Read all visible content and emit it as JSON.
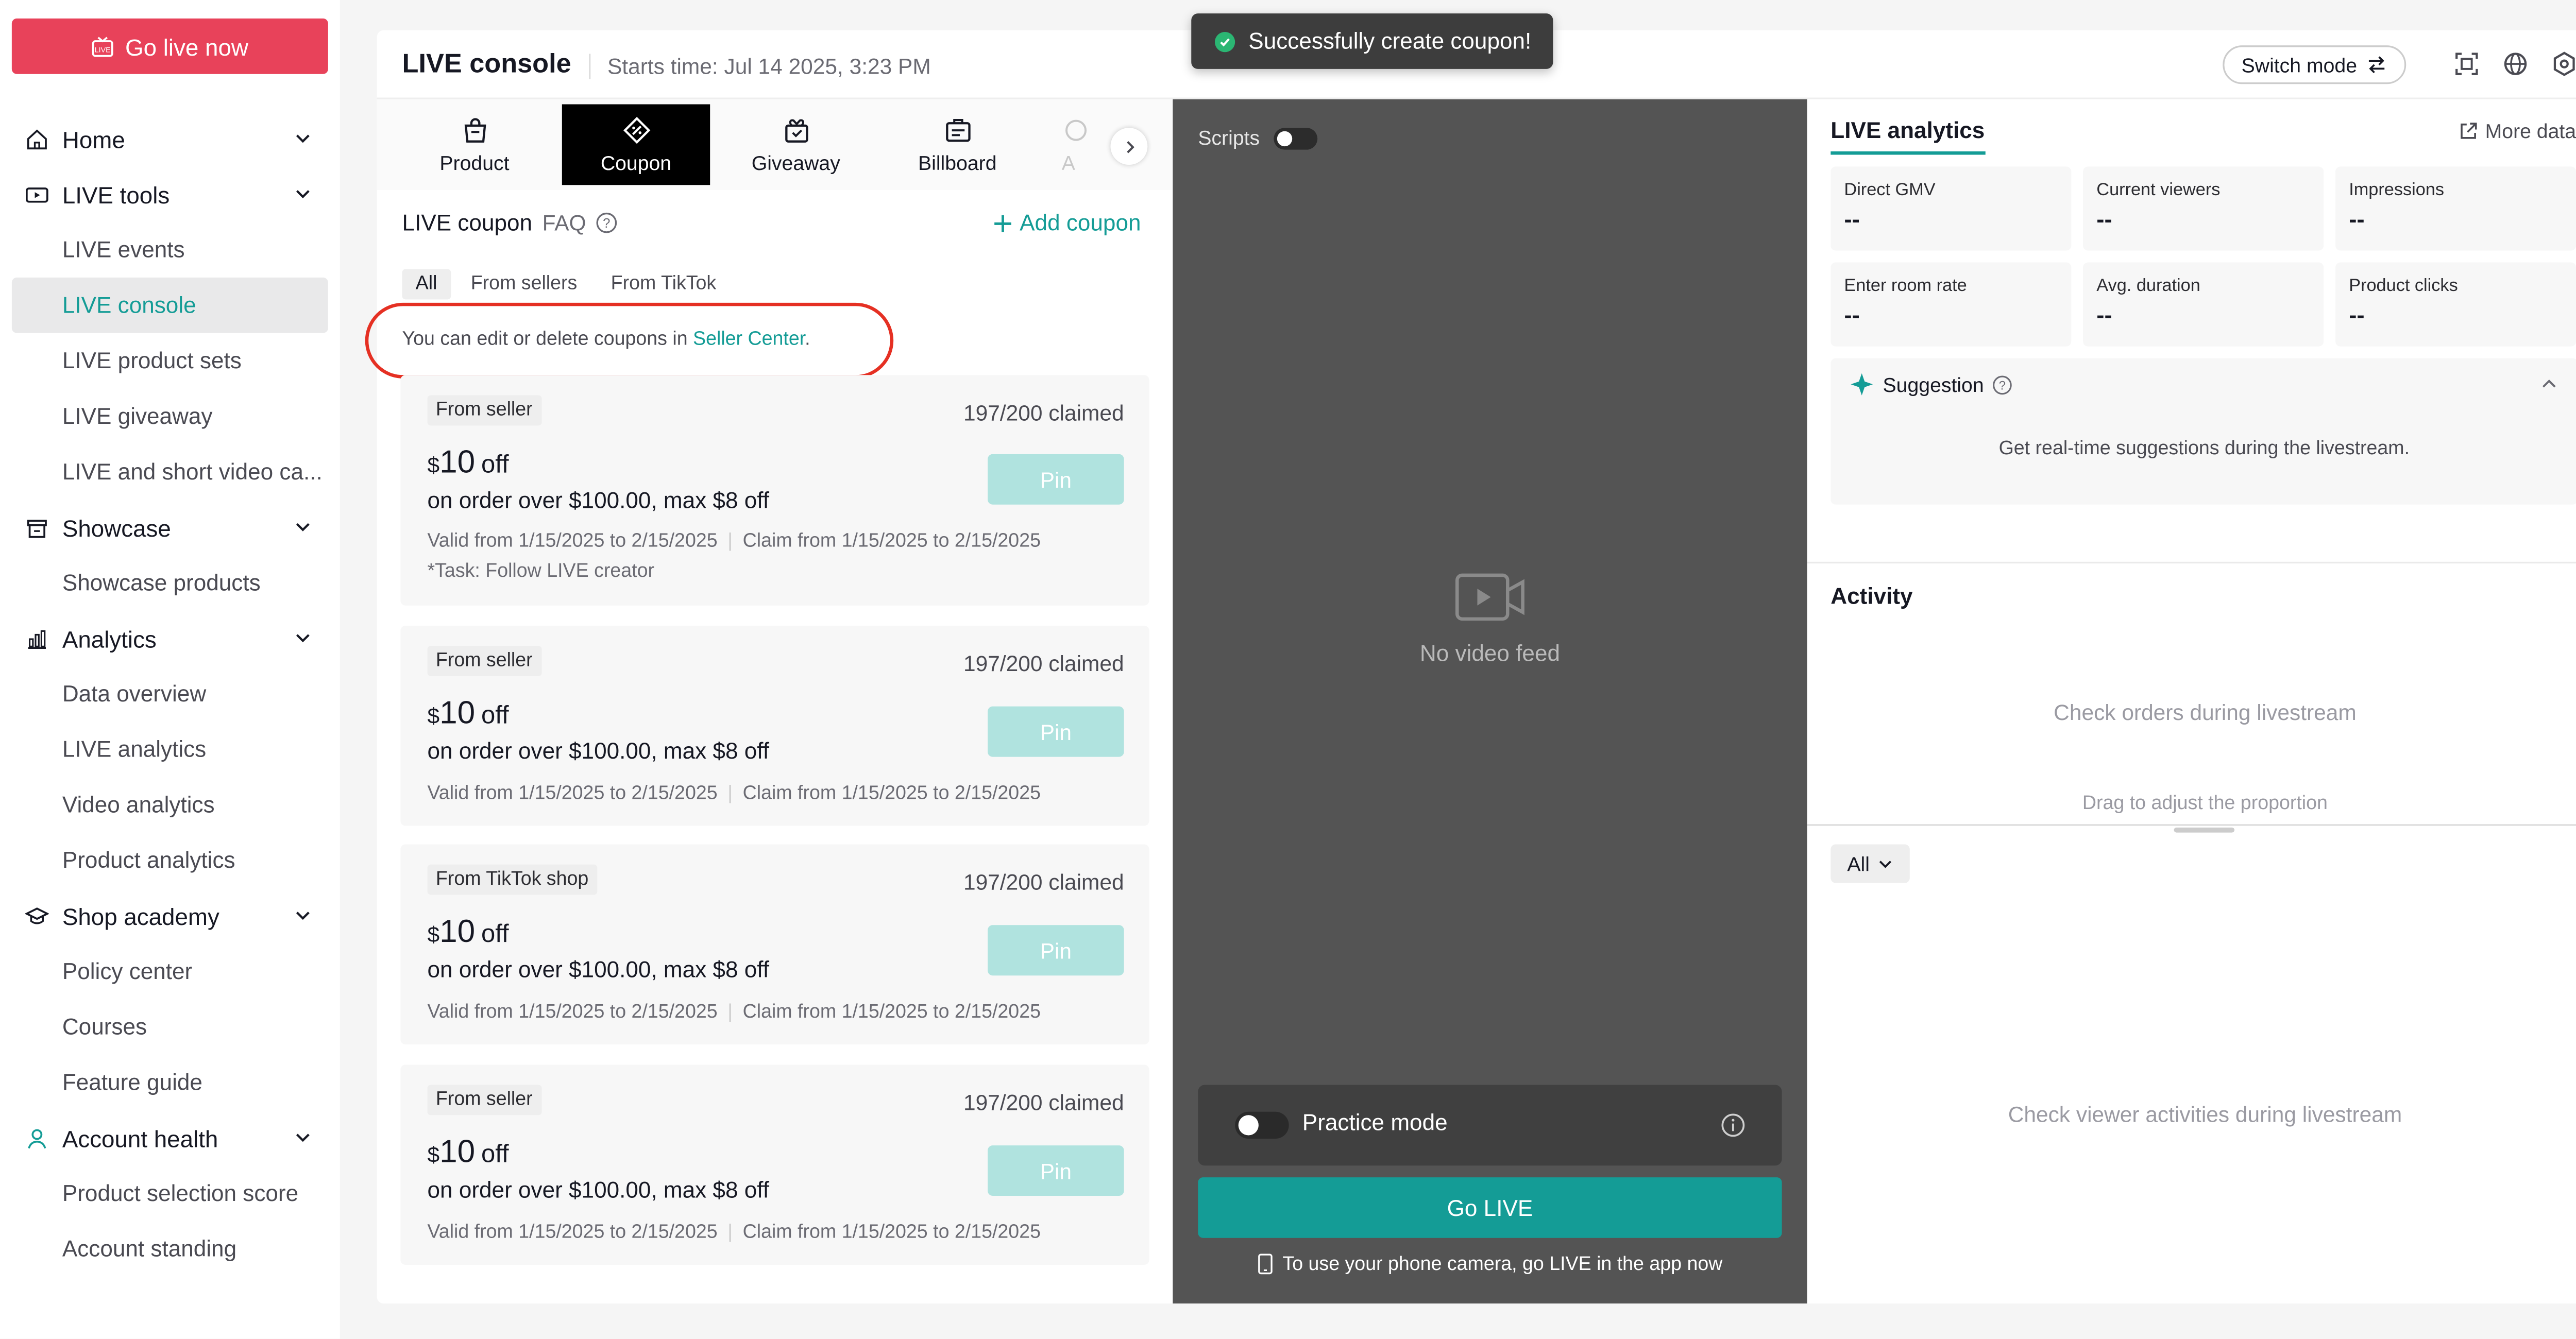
{
  "sidebar": {
    "go_live_label": "Go live now",
    "groups": [
      {
        "label": "Home",
        "icon": "home-icon",
        "subs": []
      },
      {
        "label": "LIVE tools",
        "icon": "live-tools-icon",
        "subs": [
          "LIVE events",
          "LIVE console",
          "LIVE product sets",
          "LIVE giveaway",
          "LIVE and short video ca..."
        ]
      },
      {
        "label": "Showcase",
        "icon": "showcase-icon",
        "subs": [
          "Showcase products"
        ]
      },
      {
        "label": "Analytics",
        "icon": "analytics-icon",
        "subs": [
          "Data overview",
          "LIVE analytics",
          "Video analytics",
          "Product analytics"
        ]
      },
      {
        "label": "Shop academy",
        "icon": "academy-icon",
        "subs": [
          "Policy center",
          "Courses",
          "Feature guide"
        ]
      },
      {
        "label": "Account health",
        "icon": "account-icon",
        "subs": [
          "Product selection score",
          "Account standing"
        ]
      }
    ],
    "active": "LIVE console"
  },
  "header": {
    "title": "LIVE console",
    "starts": "Starts time: Jul 14 2025, 3:23 PM",
    "switch_mode": "Switch mode"
  },
  "toast": {
    "text": "Successfully create coupon!"
  },
  "tabs": [
    {
      "label": "Product",
      "icon": "bag-icon"
    },
    {
      "label": "Coupon",
      "icon": "coupon-icon"
    },
    {
      "label": "Giveaway",
      "icon": "giveaway-icon"
    },
    {
      "label": "Billboard",
      "icon": "billboard-icon"
    },
    {
      "label": "A",
      "icon": "more-tab-icon"
    }
  ],
  "coupon_panel": {
    "title": "LIVE coupon",
    "faq": "FAQ",
    "add": "Add coupon",
    "filters": [
      "All",
      "From sellers",
      "From TikTok"
    ],
    "info_prefix": "You can edit or delete coupons in ",
    "info_link": "Seller Center",
    "info_suffix": "."
  },
  "coupons": [
    {
      "badge": "From seller",
      "claimed": "197/200 claimed",
      "currency": "$",
      "amount": "10",
      "off": "off",
      "cond": "on order over $100.00, max $8 off",
      "valid": "Valid from 1/15/2025 to 2/15/2025",
      "claim": "Claim from 1/15/2025 to 2/15/2025",
      "task": "*Task: Follow LIVE creator",
      "pin": "Pin"
    },
    {
      "badge": "From seller",
      "claimed": "197/200 claimed",
      "currency": "$",
      "amount": "10",
      "off": "off",
      "cond": "on order over $100.00, max $8 off",
      "valid": "Valid from 1/15/2025 to 2/15/2025",
      "claim": "Claim from 1/15/2025 to 2/15/2025",
      "task": "",
      "pin": "Pin"
    },
    {
      "badge": "From TikTok shop",
      "claimed": "197/200 claimed",
      "currency": "$",
      "amount": "10",
      "off": "off",
      "cond": "on order over $100.00, max $8 off",
      "valid": "Valid from 1/15/2025 to 2/15/2025",
      "claim": "Claim from 1/15/2025 to 2/15/2025",
      "task": "",
      "pin": "Pin"
    },
    {
      "badge": "From seller",
      "claimed": "197/200 claimed",
      "currency": "$",
      "amount": "10",
      "off": "off",
      "cond": "on order over $100.00, max $8 off",
      "valid": "Valid from 1/15/2025 to 2/15/2025",
      "claim": "Claim from 1/15/2025 to 2/15/2025",
      "task": "",
      "pin": "Pin"
    }
  ],
  "video": {
    "scripts": "Scripts",
    "no_feed": "No video feed",
    "practice": "Practice mode",
    "go_live": "Go LIVE",
    "phone_hint": "To use your phone camera, go LIVE in the app now"
  },
  "analytics": {
    "title": "LIVE analytics",
    "more": "More data",
    "metrics": [
      {
        "label": "Direct GMV",
        "value": "--"
      },
      {
        "label": "Current viewers",
        "value": "--"
      },
      {
        "label": "Impressions",
        "value": "--"
      },
      {
        "label": "Enter room rate",
        "value": "--"
      },
      {
        "label": "Avg. duration",
        "value": "--"
      },
      {
        "label": "Product clicks",
        "value": "--"
      }
    ],
    "suggestion_title": "Suggestion",
    "suggestion_text": "Get real-time suggestions during the livestream.",
    "activity_title": "Activity",
    "activity_empty": "Check orders during livestream",
    "drag_text": "Drag to adjust the proportion",
    "all_filter": "All",
    "viewer_empty": "Check viewer activities during livestream"
  },
  "colors": {
    "accent": "#149c96",
    "golive": "#e8425a",
    "highlight_oval": "#e53023"
  }
}
